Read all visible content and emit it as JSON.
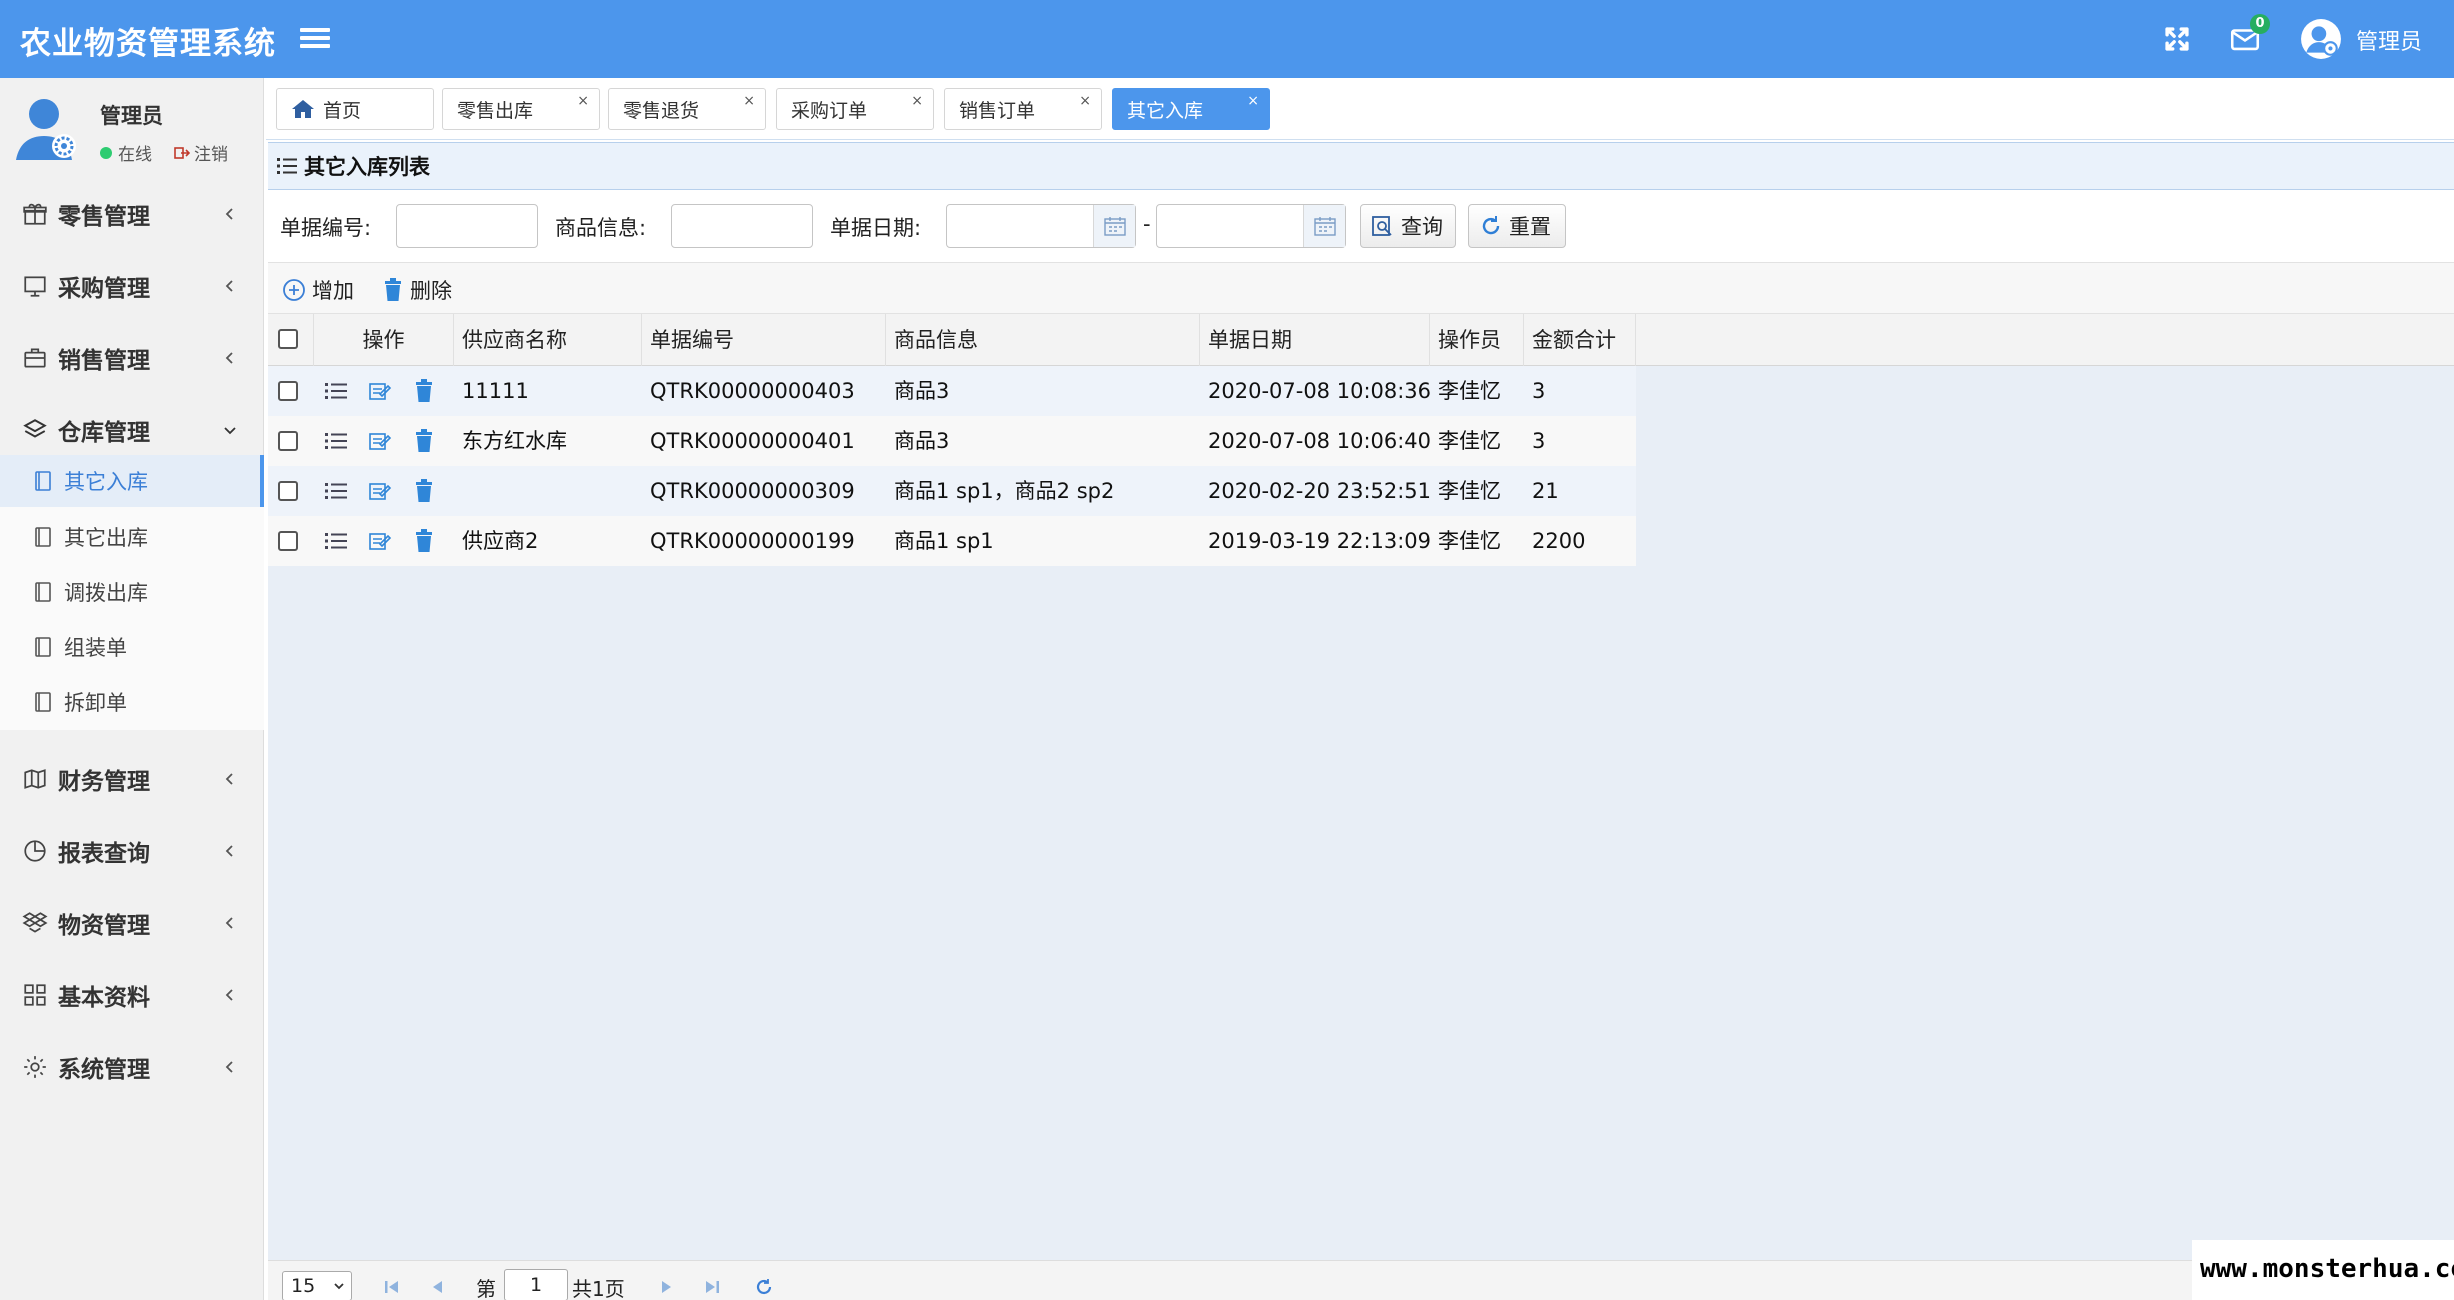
{
  "header": {
    "app_title": "农业物资管理系统",
    "mail_badge": "0",
    "user_name": "管理员"
  },
  "sidebar": {
    "user": {
      "name": "管理员",
      "status": "在线",
      "logout": "注销"
    },
    "menu": [
      {
        "label": "零售管理",
        "icon": "gift-icon"
      },
      {
        "label": "采购管理",
        "icon": "monitor-icon"
      },
      {
        "label": "销售管理",
        "icon": "briefcase-icon"
      },
      {
        "label": "仓库管理",
        "icon": "layers-icon"
      },
      {
        "label": "财务管理",
        "icon": "map-icon"
      },
      {
        "label": "报表查询",
        "icon": "pie-chart-icon"
      },
      {
        "label": "物资管理",
        "icon": "dropbox-icon"
      },
      {
        "label": "基本资料",
        "icon": "grid-icon"
      },
      {
        "label": "系统管理",
        "icon": "gear-icon"
      }
    ],
    "submenu": [
      {
        "label": "其它入库"
      },
      {
        "label": "其它出库"
      },
      {
        "label": "调拨出库"
      },
      {
        "label": "组装单"
      },
      {
        "label": "拆卸单"
      }
    ]
  },
  "tabs": [
    {
      "label": "首页",
      "close": ""
    },
    {
      "label": "零售出库",
      "close": "×"
    },
    {
      "label": "零售退货",
      "close": "×"
    },
    {
      "label": "采购订单",
      "close": "×"
    },
    {
      "label": "销售订单",
      "close": "×"
    },
    {
      "label": "其它入库",
      "close": "×"
    }
  ],
  "panel_title": "其它入库列表",
  "search": {
    "doc_no_label": "单据编号:",
    "goods_label": "商品信息:",
    "date_label": "单据日期:",
    "date_sep": "-",
    "query_label": "查询",
    "reset_label": "重置"
  },
  "toolbar": {
    "add_label": "增加",
    "delete_label": "删除"
  },
  "table": {
    "columns": [
      "操作",
      "供应商名称",
      "单据编号",
      "商品信息",
      "单据日期",
      "操作员",
      "金额合计"
    ],
    "rows": [
      {
        "supplier": "11111",
        "doc_no": "QTRK00000000403",
        "goods": "商品3",
        "date": "2020-07-08 10:08:36",
        "operator": "李佳忆",
        "total": "3"
      },
      {
        "supplier": "东方红水库",
        "doc_no": "QTRK00000000401",
        "goods": "商品3",
        "date": "2020-07-08 10:06:40",
        "operator": "李佳忆",
        "total": "3"
      },
      {
        "supplier": "",
        "doc_no": "QTRK00000000309",
        "goods": "商品1 sp1，商品2 sp2",
        "date": "2020-02-20 23:52:51",
        "operator": "李佳忆",
        "total": "21"
      },
      {
        "supplier": "供应商2",
        "doc_no": "QTRK00000000199",
        "goods": "商品1 sp1",
        "date": "2019-03-19 22:13:09",
        "operator": "李佳忆",
        "total": "2200"
      }
    ]
  },
  "pager": {
    "page_size": "15",
    "page_prefix": "第",
    "page_value": "1",
    "page_total": "共1页"
  },
  "watermark": "www.monsterhua.com",
  "colors": {
    "primary": "#4c96ec",
    "online": "#2ecc71",
    "badge": "#27ae60"
  }
}
